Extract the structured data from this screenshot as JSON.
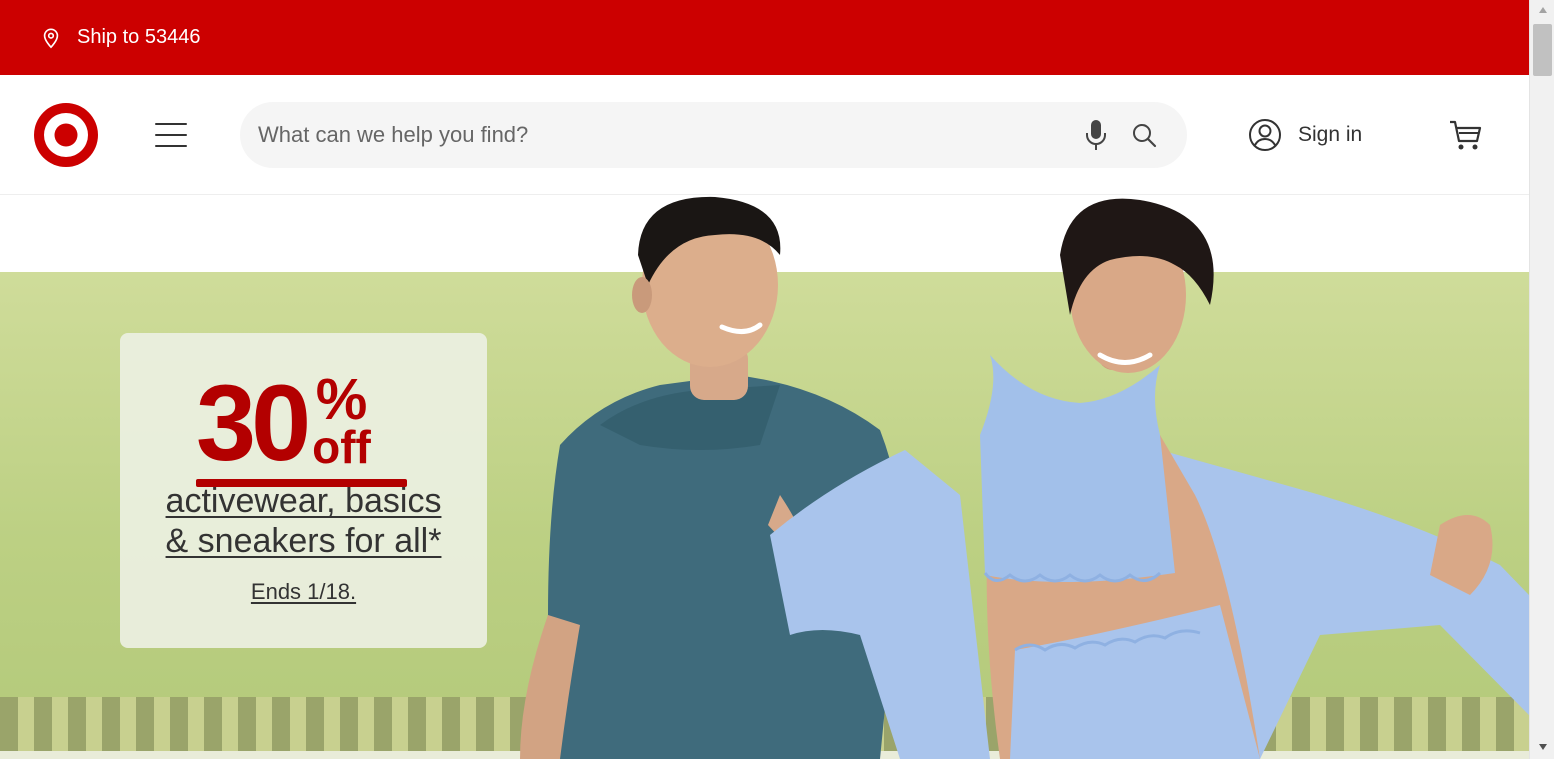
{
  "ship_bar": {
    "label": "Ship to 53446",
    "icon": "location-pin-icon",
    "color": "#cc0000"
  },
  "header": {
    "logo": "target-bullseye-logo",
    "menu_icon": "hamburger-menu-icon",
    "search": {
      "placeholder": "What can we help you find?",
      "value": "",
      "mic_icon": "microphone-icon",
      "search_icon": "search-icon"
    },
    "signin": {
      "label": "Sign in",
      "icon": "account-circle-icon"
    },
    "cart_icon": "shopping-cart-icon"
  },
  "hero": {
    "amount": "30",
    "percent": "%",
    "off": "off",
    "line1": "activewear, basics",
    "line2": "& sneakers for all*",
    "ends": "Ends 1/18.",
    "accent_color": "#b30000",
    "background_color": "#c5d68c"
  },
  "scrollbar": {
    "up_icon": "scroll-up-arrow-icon",
    "down_icon": "scroll-down-arrow-icon"
  }
}
